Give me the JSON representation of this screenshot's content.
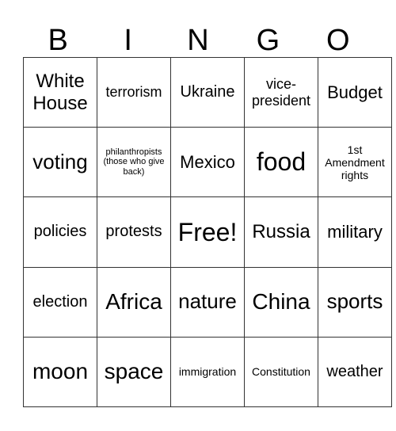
{
  "header": [
    "B",
    "I",
    "N",
    "G",
    "O"
  ],
  "rows": [
    [
      "White House",
      "terrorism",
      "Ukraine",
      "vice-president",
      "Budget"
    ],
    [
      "voting",
      "philanthropists (those who give back)",
      "Mexico",
      "food",
      "1st Amendment rights"
    ],
    [
      "policies",
      "protests",
      "Free!",
      "Russia",
      "military"
    ],
    [
      "election",
      "Africa",
      "nature",
      "China",
      "sports"
    ],
    [
      "moon",
      "space",
      "immigration",
      "Constitution",
      "weather"
    ]
  ]
}
